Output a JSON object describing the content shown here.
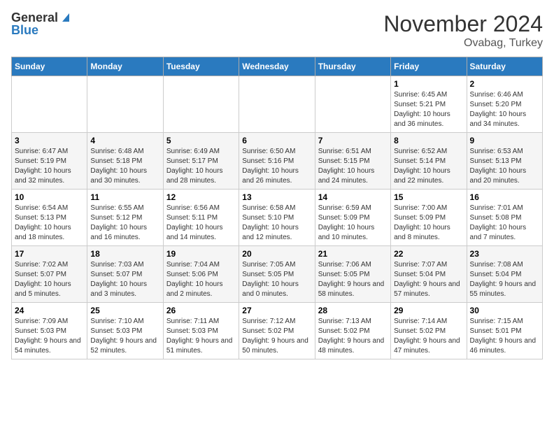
{
  "header": {
    "logo_general": "General",
    "logo_blue": "Blue",
    "month": "November 2024",
    "location": "Ovabag, Turkey"
  },
  "weekdays": [
    "Sunday",
    "Monday",
    "Tuesday",
    "Wednesday",
    "Thursday",
    "Friday",
    "Saturday"
  ],
  "weeks": [
    [
      {
        "day": "",
        "sunrise": "",
        "sunset": "",
        "daylight": ""
      },
      {
        "day": "",
        "sunrise": "",
        "sunset": "",
        "daylight": ""
      },
      {
        "day": "",
        "sunrise": "",
        "sunset": "",
        "daylight": ""
      },
      {
        "day": "",
        "sunrise": "",
        "sunset": "",
        "daylight": ""
      },
      {
        "day": "",
        "sunrise": "",
        "sunset": "",
        "daylight": ""
      },
      {
        "day": "1",
        "sunrise": "Sunrise: 6:45 AM",
        "sunset": "Sunset: 5:21 PM",
        "daylight": "Daylight: 10 hours and 36 minutes."
      },
      {
        "day": "2",
        "sunrise": "Sunrise: 6:46 AM",
        "sunset": "Sunset: 5:20 PM",
        "daylight": "Daylight: 10 hours and 34 minutes."
      }
    ],
    [
      {
        "day": "3",
        "sunrise": "Sunrise: 6:47 AM",
        "sunset": "Sunset: 5:19 PM",
        "daylight": "Daylight: 10 hours and 32 minutes."
      },
      {
        "day": "4",
        "sunrise": "Sunrise: 6:48 AM",
        "sunset": "Sunset: 5:18 PM",
        "daylight": "Daylight: 10 hours and 30 minutes."
      },
      {
        "day": "5",
        "sunrise": "Sunrise: 6:49 AM",
        "sunset": "Sunset: 5:17 PM",
        "daylight": "Daylight: 10 hours and 28 minutes."
      },
      {
        "day": "6",
        "sunrise": "Sunrise: 6:50 AM",
        "sunset": "Sunset: 5:16 PM",
        "daylight": "Daylight: 10 hours and 26 minutes."
      },
      {
        "day": "7",
        "sunrise": "Sunrise: 6:51 AM",
        "sunset": "Sunset: 5:15 PM",
        "daylight": "Daylight: 10 hours and 24 minutes."
      },
      {
        "day": "8",
        "sunrise": "Sunrise: 6:52 AM",
        "sunset": "Sunset: 5:14 PM",
        "daylight": "Daylight: 10 hours and 22 minutes."
      },
      {
        "day": "9",
        "sunrise": "Sunrise: 6:53 AM",
        "sunset": "Sunset: 5:13 PM",
        "daylight": "Daylight: 10 hours and 20 minutes."
      }
    ],
    [
      {
        "day": "10",
        "sunrise": "Sunrise: 6:54 AM",
        "sunset": "Sunset: 5:13 PM",
        "daylight": "Daylight: 10 hours and 18 minutes."
      },
      {
        "day": "11",
        "sunrise": "Sunrise: 6:55 AM",
        "sunset": "Sunset: 5:12 PM",
        "daylight": "Daylight: 10 hours and 16 minutes."
      },
      {
        "day": "12",
        "sunrise": "Sunrise: 6:56 AM",
        "sunset": "Sunset: 5:11 PM",
        "daylight": "Daylight: 10 hours and 14 minutes."
      },
      {
        "day": "13",
        "sunrise": "Sunrise: 6:58 AM",
        "sunset": "Sunset: 5:10 PM",
        "daylight": "Daylight: 10 hours and 12 minutes."
      },
      {
        "day": "14",
        "sunrise": "Sunrise: 6:59 AM",
        "sunset": "Sunset: 5:09 PM",
        "daylight": "Daylight: 10 hours and 10 minutes."
      },
      {
        "day": "15",
        "sunrise": "Sunrise: 7:00 AM",
        "sunset": "Sunset: 5:09 PM",
        "daylight": "Daylight: 10 hours and 8 minutes."
      },
      {
        "day": "16",
        "sunrise": "Sunrise: 7:01 AM",
        "sunset": "Sunset: 5:08 PM",
        "daylight": "Daylight: 10 hours and 7 minutes."
      }
    ],
    [
      {
        "day": "17",
        "sunrise": "Sunrise: 7:02 AM",
        "sunset": "Sunset: 5:07 PM",
        "daylight": "Daylight: 10 hours and 5 minutes."
      },
      {
        "day": "18",
        "sunrise": "Sunrise: 7:03 AM",
        "sunset": "Sunset: 5:07 PM",
        "daylight": "Daylight: 10 hours and 3 minutes."
      },
      {
        "day": "19",
        "sunrise": "Sunrise: 7:04 AM",
        "sunset": "Sunset: 5:06 PM",
        "daylight": "Daylight: 10 hours and 2 minutes."
      },
      {
        "day": "20",
        "sunrise": "Sunrise: 7:05 AM",
        "sunset": "Sunset: 5:05 PM",
        "daylight": "Daylight: 10 hours and 0 minutes."
      },
      {
        "day": "21",
        "sunrise": "Sunrise: 7:06 AM",
        "sunset": "Sunset: 5:05 PM",
        "daylight": "Daylight: 9 hours and 58 minutes."
      },
      {
        "day": "22",
        "sunrise": "Sunrise: 7:07 AM",
        "sunset": "Sunset: 5:04 PM",
        "daylight": "Daylight: 9 hours and 57 minutes."
      },
      {
        "day": "23",
        "sunrise": "Sunrise: 7:08 AM",
        "sunset": "Sunset: 5:04 PM",
        "daylight": "Daylight: 9 hours and 55 minutes."
      }
    ],
    [
      {
        "day": "24",
        "sunrise": "Sunrise: 7:09 AM",
        "sunset": "Sunset: 5:03 PM",
        "daylight": "Daylight: 9 hours and 54 minutes."
      },
      {
        "day": "25",
        "sunrise": "Sunrise: 7:10 AM",
        "sunset": "Sunset: 5:03 PM",
        "daylight": "Daylight: 9 hours and 52 minutes."
      },
      {
        "day": "26",
        "sunrise": "Sunrise: 7:11 AM",
        "sunset": "Sunset: 5:03 PM",
        "daylight": "Daylight: 9 hours and 51 minutes."
      },
      {
        "day": "27",
        "sunrise": "Sunrise: 7:12 AM",
        "sunset": "Sunset: 5:02 PM",
        "daylight": "Daylight: 9 hours and 50 minutes."
      },
      {
        "day": "28",
        "sunrise": "Sunrise: 7:13 AM",
        "sunset": "Sunset: 5:02 PM",
        "daylight": "Daylight: 9 hours and 48 minutes."
      },
      {
        "day": "29",
        "sunrise": "Sunrise: 7:14 AM",
        "sunset": "Sunset: 5:02 PM",
        "daylight": "Daylight: 9 hours and 47 minutes."
      },
      {
        "day": "30",
        "sunrise": "Sunrise: 7:15 AM",
        "sunset": "Sunset: 5:01 PM",
        "daylight": "Daylight: 9 hours and 46 minutes."
      }
    ]
  ]
}
